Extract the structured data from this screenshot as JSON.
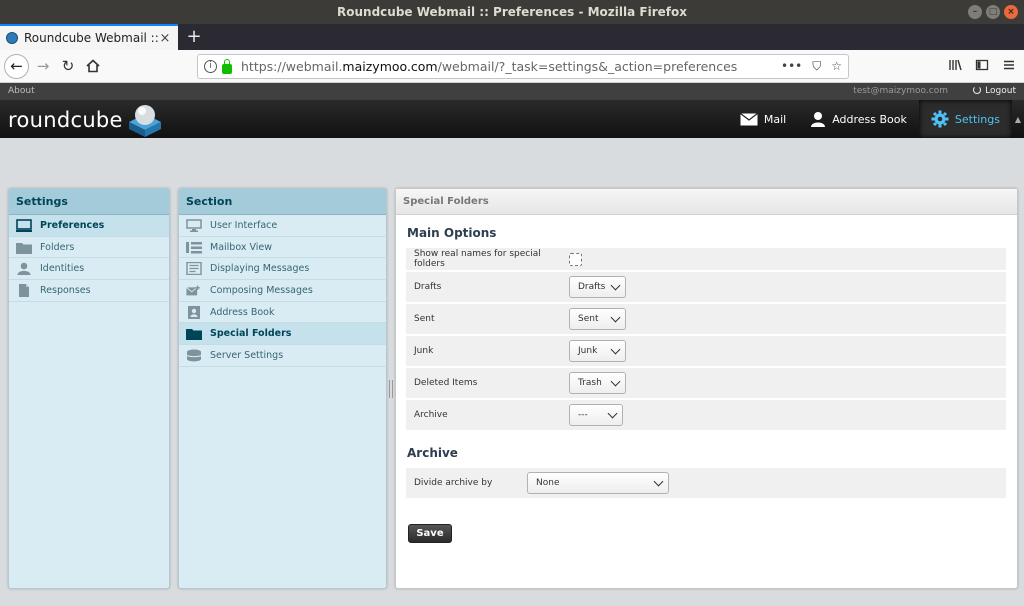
{
  "window": {
    "title": "Roundcube Webmail :: Preferences - Mozilla Firefox",
    "controls": {
      "minimize": "–",
      "maximize": "□",
      "close": "×"
    }
  },
  "browser": {
    "tab_title": "Roundcube Webmail :: P",
    "tab_close": "×",
    "new_tab": "+",
    "url_prefix": "https://webmail.",
    "url_domain": "maizymoo.com",
    "url_suffix": "/webmail/?_task=settings&_action=preferences",
    "url_actions": [
      "•••",
      "⛉",
      "☆"
    ],
    "toolbar_icons": [
      "library-icon",
      "sidebar-icon",
      "menu-icon"
    ]
  },
  "topline": {
    "about": "About",
    "user": "test@maizymoo.com",
    "logout": "Logout"
  },
  "header": {
    "logo": "roundcube",
    "nav": [
      {
        "label": "Mail",
        "icon": "envelope-icon"
      },
      {
        "label": "Address Book",
        "icon": "person-icon"
      },
      {
        "label": "Settings",
        "icon": "gear-icon",
        "active": true
      }
    ],
    "accent": "#4fc3f7"
  },
  "settings_panel": {
    "title": "Settings",
    "items": [
      {
        "label": "Preferences",
        "icon": "computer-icon",
        "selected": true
      },
      {
        "label": "Folders",
        "icon": "folder-icon"
      },
      {
        "label": "Identities",
        "icon": "identity-icon"
      },
      {
        "label": "Responses",
        "icon": "document-icon"
      }
    ]
  },
  "section_panel": {
    "title": "Section",
    "items": [
      {
        "label": "User Interface",
        "icon": "monitor-icon"
      },
      {
        "label": "Mailbox View",
        "icon": "list-icon"
      },
      {
        "label": "Displaying Messages",
        "icon": "message-view-icon"
      },
      {
        "label": "Composing Messages",
        "icon": "compose-icon"
      },
      {
        "label": "Address Book",
        "icon": "addressbook-icon"
      },
      {
        "label": "Special Folders",
        "icon": "folder-dark-icon",
        "selected": true
      },
      {
        "label": "Server Settings",
        "icon": "server-icon"
      }
    ]
  },
  "content": {
    "title": "Special Folders",
    "main_options": {
      "legend": "Main Options",
      "show_real_names_label": "Show real names for special folders",
      "show_real_names_checked": false,
      "rows": [
        {
          "label": "Drafts",
          "value": "Drafts"
        },
        {
          "label": "Sent",
          "value": "Sent"
        },
        {
          "label": "Junk",
          "value": "Junk"
        },
        {
          "label": "Deleted Items",
          "value": "Trash"
        },
        {
          "label": "Archive",
          "value": "---"
        }
      ]
    },
    "archive": {
      "legend": "Archive",
      "divide_label": "Divide archive by",
      "divide_value": "None"
    },
    "save_label": "Save"
  }
}
